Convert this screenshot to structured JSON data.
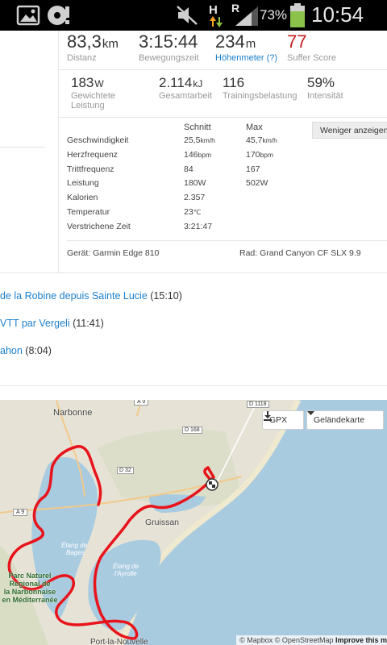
{
  "status_bar": {
    "battery_percent": "73%",
    "time": "10:54",
    "network_h": "H",
    "network_r": "R",
    "icons": [
      "gallery-icon",
      "disc-alert-icon",
      "mute-icon",
      "data-arrows-icon",
      "signal-icon",
      "battery-icon"
    ]
  },
  "activity": {
    "distance": {
      "value": "83,3",
      "unit": "km",
      "label": "Distanz"
    },
    "moving_time": {
      "value": "3:15:44",
      "label": "Bewegungszeit"
    },
    "elevation": {
      "value": "234",
      "unit": "m",
      "label": "Höhenmeter (?)"
    },
    "suffer_score": {
      "value": "77",
      "label": "Suffer Score"
    },
    "weighted_power": {
      "value": "183",
      "unit": "W",
      "label_line1": "Gewichtete",
      "label_line2": "Leistung"
    },
    "total_work": {
      "value": "2.114",
      "unit": "kJ",
      "label": "Gesamtarbeit"
    },
    "training_load": {
      "value": "116",
      "label": "Trainingsbelastung"
    },
    "intensity": {
      "value": "59%",
      "label": "Intensität"
    }
  },
  "details": {
    "col_avg": "Schnitt",
    "col_max": "Max",
    "less_button": "Weniger anzeigen",
    "rows": [
      {
        "label": "Geschwindigkeit",
        "avg": "25,5",
        "avg_unit": "km/h",
        "max": "45,7",
        "max_unit": "km/h"
      },
      {
        "label": "Herzfrequenz",
        "avg": "146",
        "avg_unit": "bpm",
        "max": "170",
        "max_unit": "bpm"
      },
      {
        "label": "Trittfrequenz",
        "avg": "84",
        "avg_unit": "",
        "max": "167",
        "max_unit": ""
      },
      {
        "label": "Leistung",
        "avg": "180W",
        "avg_unit": "",
        "max": "502W",
        "max_unit": ""
      },
      {
        "label": "Kalorien",
        "avg": "2.357",
        "avg_unit": "",
        "max": "",
        "max_unit": ""
      },
      {
        "label": "Temperatur",
        "avg": "23",
        "avg_unit": "℃",
        "max": "",
        "max_unit": ""
      },
      {
        "label": "Verstrichene Zeit",
        "avg": "3:21:47",
        "avg_unit": "",
        "max": "",
        "max_unit": ""
      }
    ],
    "device": "Gerät: Garmin Edge 810",
    "bike": "Rad: Grand Canyon CF SLX 9.9"
  },
  "segments": [
    {
      "name": "de la Robine depuis Sainte Lucie",
      "time": "(15:10)"
    },
    {
      "name": "VTT par Vergeli",
      "time": "(11:41)"
    },
    {
      "name": "ahon",
      "time": "(8:04)"
    }
  ],
  "map": {
    "gpx_button": "GPX",
    "terrain_button": "Geländekarte",
    "attribution_mapbox": "© Mapbox",
    "attribution_osm": "© OpenStreetMap",
    "attribution_improve": "Improve this m",
    "labels": {
      "narbonne": "Narbonne",
      "gruissan": "Gruissan",
      "etang_bages_1": "Étang de",
      "etang_bages_2": "Bages",
      "etang_ayrolle_1": "Étang de",
      "etang_ayrolle_2": "l'Ayrolle",
      "parc_1": "Parc Naturel",
      "parc_2": "Regional de",
      "parc_3": "la Narbonnaise",
      "parc_4": "en Méditerranée",
      "port": "Port-la-Nouvelle",
      "road_a9_top": "A 9",
      "road_a9_left": "A 9",
      "road_d1118": "D 1118",
      "road_d168": "D 168",
      "road_d32": "D 32"
    },
    "route_color": "#e8141c",
    "sea_color": "#a9cbe0",
    "land_color": "#e6e3d6"
  }
}
